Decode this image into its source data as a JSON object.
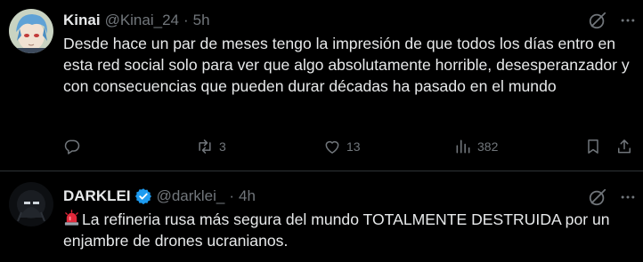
{
  "tweets": [
    {
      "name": "Kinai",
      "handle": "@Kinai_24",
      "separator": "·",
      "time": "5h",
      "verified": false,
      "text": "Desde hace un par de meses tengo la impresión de que todos los días entro en esta red social solo para ver que algo absolutamente horrible, desesperanzador y con consecuencias que pueden durar décadas ha pasado en el mundo",
      "actions": {
        "reply_count": "",
        "retweet_count": "3",
        "like_count": "13",
        "views_count": "382"
      },
      "icons": [
        "grok-icon",
        "more-icon",
        "reply-icon",
        "retweet-icon",
        "like-icon",
        "views-icon",
        "bookmark-icon",
        "share-icon"
      ]
    },
    {
      "name": "DARKLEI",
      "handle": "@darklei_",
      "separator": "·",
      "time": "4h",
      "verified": true,
      "text": "La refineria rusa más segura del mundo TOTALMENTE DESTRUIDA por un enjambre de drones ucranianos.",
      "leading_emoji": "siren-icon",
      "icons": [
        "verified-badge-icon",
        "grok-icon",
        "more-icon"
      ]
    }
  ],
  "colors": {
    "background": "#000000",
    "text": "#e7e9ea",
    "secondary": "#71767b",
    "divider": "#2f3336",
    "verified": "#1d9bf0"
  }
}
